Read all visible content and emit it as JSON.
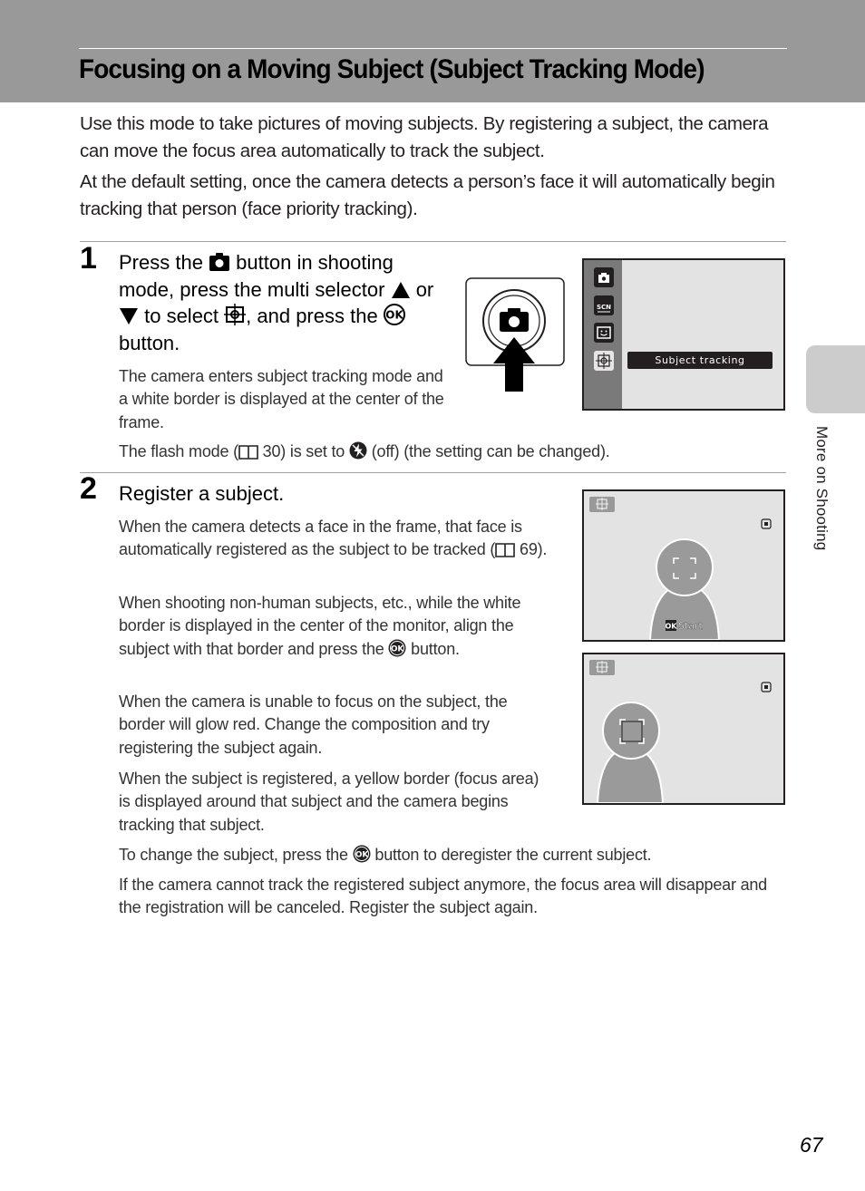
{
  "header": {
    "title": "Focusing on a Moving Subject (Subject Tracking Mode)"
  },
  "intro": {
    "paragraph_1": "Use this mode to take pictures of moving subjects. By registering a subject, the camera can move the focus area automatically to track the subject.",
    "paragraph_2": "At the default setting, once the camera detects a person’s face it will automatically begin tracking that person (face priority tracking)."
  },
  "step1": {
    "number": "1",
    "heading_parts": [
      "Press the ",
      " button in shooting mode, press the multi selector ",
      " or ",
      " to select ",
      ", and press the ",
      " button."
    ],
    "heading_icons": [
      "camera-icon",
      "up-triangle-icon",
      "down-triangle-icon",
      "subject-tracking-icon",
      "ok-button-icon"
    ],
    "body": "The camera enters subject tracking mode and a white border is displayed at the center of the frame.",
    "note_parts": [
      "The flash mode (",
      " 30) is set to ",
      " (off) (the setting can be changed)."
    ],
    "note_icons": [
      "book-reference-icon",
      "flash-off-icon"
    ],
    "menu": {
      "items": [
        "auto-mode-icon",
        "scene-icon",
        "smart-portrait-icon",
        "subject-tracking-icon"
      ],
      "selected_label": "Subject tracking"
    }
  },
  "step2": {
    "number": "2",
    "heading": "Register a subject.",
    "p1_parts": [
      "When the camera detects a face in the frame, that face is automatically registered as the subject to be tracked (",
      " 69)."
    ],
    "p2_parts": [
      "When shooting non-human subjects, etc., while the white border is displayed in the center of the monitor, align the subject with that border and press the ",
      " button."
    ],
    "p3": "When the camera is unable to focus on the subject, the border will glow red. Change the composition and try registering the subject again.",
    "p4": "When the subject is registered, a yellow border (focus area) is displayed around that subject and the camera begins tracking that subject.",
    "p5_parts": [
      "To change the subject, press the ",
      " button to deregister the current subject."
    ],
    "p6": "If the camera cannot track the registered subject anymore, the focus area will disappear and the registration will be canceled. Register the subject again.",
    "screen1": {
      "ok_badge": "OK",
      "ok_text": "Start"
    }
  },
  "sidebar": {
    "section_label": "More on Shooting"
  },
  "footer": {
    "page_number": "67"
  },
  "colors": {
    "header_band": "#999999",
    "lcd_background": "#e3e3e3",
    "subject_fill": "#9a9a9a",
    "side_tab": "#cccccc"
  }
}
